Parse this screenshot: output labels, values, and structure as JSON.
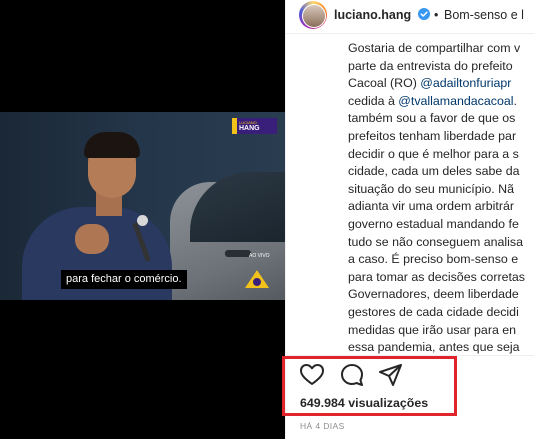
{
  "video": {
    "logo_top": "LUCIANO",
    "logo_bottom": "HANG",
    "subtitle": "para fechar o comércio.",
    "live_label": "AO VIVO"
  },
  "post": {
    "username": "luciano.hang",
    "header_caption": "Bom-senso e l",
    "separator": "•",
    "caption_lines": [
      "Gostaria de compartilhar com v",
      "parte da entrevista do prefeito",
      "Cacoal (RO) ",
      "cedida à ",
      "também sou a favor de que os",
      "prefeitos tenham liberdade par",
      "decidir o que é melhor para a s",
      "cidade, cada um deles sabe da",
      "situação do seu município. Nã",
      "adianta vir uma ordem arbitrár",
      "governo estadual mandando fe",
      "tudo se não conseguem analisa",
      "a caso. É preciso bom-senso e",
      "para tomar as decisões corretas",
      "Governadores, deem liberdade",
      "gestores de cada cidade decidi",
      "medidas que irão usar para en",
      "essa pandemia, antes que seja"
    ],
    "mention_1": "@adailtonfuriapr",
    "mention_2": "@tvallamandacacoal",
    "after_mention_2": ".",
    "views": "649.984 visualizações",
    "timestamp": "HÁ 4 DIAS"
  },
  "icons": {
    "like": "heart-icon",
    "comment": "comment-bubble-icon",
    "share": "paper-plane-icon",
    "verified": "verified-badge-icon"
  },
  "colors": {
    "highlight": "#e0242b",
    "mention": "#00376b",
    "verified": "#3897f0",
    "text": "#262626",
    "muted": "#8e8e8e"
  }
}
